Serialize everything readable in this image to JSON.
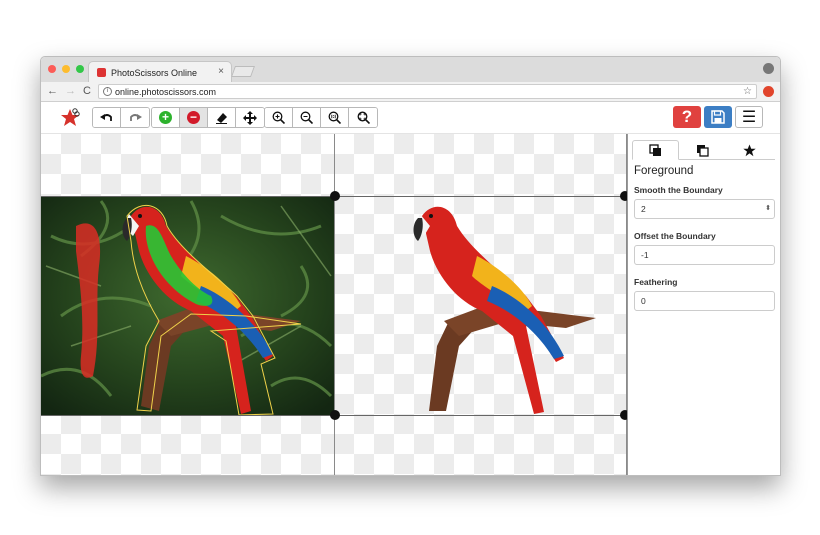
{
  "browser": {
    "tab_title": "PhotoScissors Online",
    "tab_close": "×",
    "url": "online.photoscissors.com",
    "url_info": "i",
    "nav_back": "←",
    "nav_forward": "→",
    "nav_reload": "C",
    "bookmark_star": "☆"
  },
  "toolbar": {
    "help_label": "?",
    "menu_label": "☰",
    "add_label": "+",
    "remove_label": "−"
  },
  "panel": {
    "tabs": [
      "foreground-tab",
      "background-tab",
      "favorites-tab"
    ],
    "title": "Foreground",
    "smooth_label": "Smooth the Boundary",
    "smooth_value": "2",
    "offset_label": "Offset the Boundary",
    "offset_value": "-1",
    "feather_label": "Feathering",
    "feather_value": "0"
  },
  "colors": {
    "help": "#e0413f",
    "save": "#3c7ec4",
    "add": "#2eb32e",
    "remove": "#d21a2a",
    "marker_green": "#27c735",
    "marker_red": "#d92d24"
  }
}
